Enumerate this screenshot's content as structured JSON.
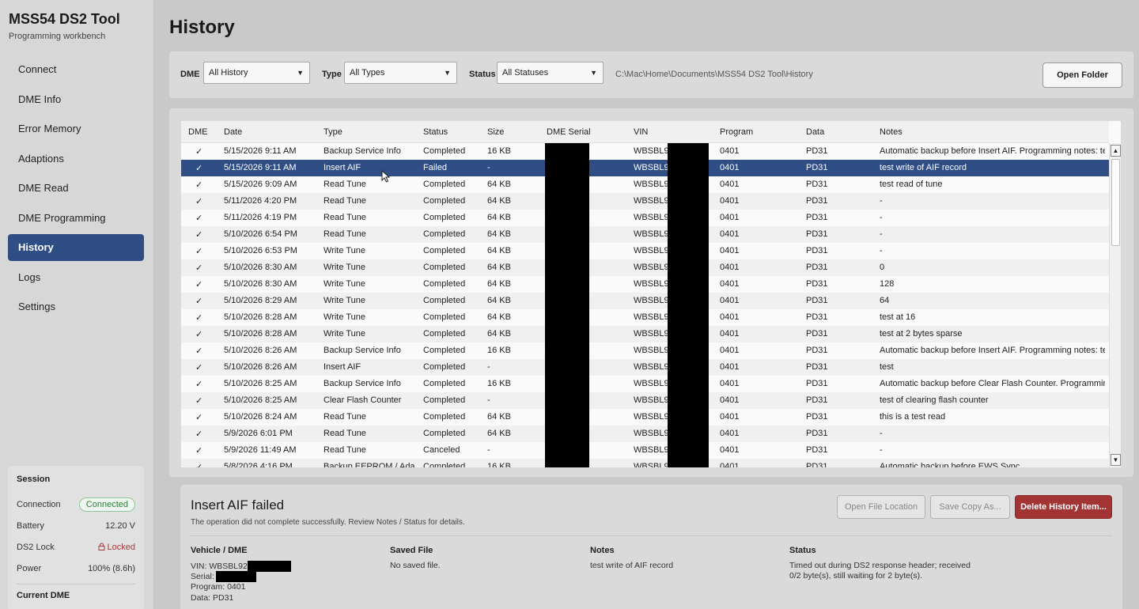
{
  "app": {
    "title": "MSS54 DS2 Tool",
    "subtitle": "Programming workbench"
  },
  "nav": [
    {
      "label": "Connect",
      "active": false
    },
    {
      "label": "DME Info",
      "active": false
    },
    {
      "label": "Error Memory",
      "active": false
    },
    {
      "label": "Adaptions",
      "active": false
    },
    {
      "label": "DME Read",
      "active": false
    },
    {
      "label": "DME Programming",
      "active": false
    },
    {
      "label": "History",
      "active": true
    },
    {
      "label": "Logs",
      "active": false
    },
    {
      "label": "Settings",
      "active": false
    }
  ],
  "session": {
    "title": "Session",
    "connection_label": "Connection",
    "connection_value": "Connected",
    "battery_label": "Battery",
    "battery_value": "12.20 V",
    "lock_label": "DS2 Lock",
    "lock_value": "Locked",
    "power_label": "Power",
    "power_value": "100% (8.6h)",
    "current_dme_label": "Current DME"
  },
  "page": {
    "title": "History"
  },
  "filters": {
    "dme_label": "DME",
    "dme_value": "All History",
    "type_label": "Type",
    "type_value": "All Types",
    "status_label": "Status",
    "status_value": "All Statuses",
    "path": "C:\\Mac\\Home\\Documents\\MSS54 DS2 Tool\\History",
    "open_folder": "Open Folder"
  },
  "table": {
    "headers": [
      "DME",
      "Date",
      "Type",
      "Status",
      "Size",
      "DME Serial",
      "VIN",
      "Program",
      "Data",
      "Notes"
    ],
    "selected_index": 1,
    "rows": [
      [
        "✓",
        "5/15/2026 9:11 AM",
        "Backup Service Info",
        "Completed",
        "16 KB",
        "",
        "WBSBL92",
        "0401",
        "PD31",
        "Automatic backup before Insert AIF. Programming notes: test..."
      ],
      [
        "✓",
        "5/15/2026 9:11 AM",
        "Insert AIF",
        "Failed",
        "-",
        "",
        "WBSBL92",
        "0401",
        "PD31",
        "test write of AIF record"
      ],
      [
        "✓",
        "5/15/2026 9:09 AM",
        "Read Tune",
        "Completed",
        "64 KB",
        "",
        "WBSBL92",
        "0401",
        "PD31",
        "test read of tune"
      ],
      [
        "✓",
        "5/11/2026 4:20 PM",
        "Read Tune",
        "Completed",
        "64 KB",
        "",
        "WBSBL92",
        "0401",
        "PD31",
        "-"
      ],
      [
        "✓",
        "5/11/2026 4:19 PM",
        "Read Tune",
        "Completed",
        "64 KB",
        "",
        "WBSBL92",
        "0401",
        "PD31",
        "-"
      ],
      [
        "✓",
        "5/10/2026 6:54 PM",
        "Read Tune",
        "Completed",
        "64 KB",
        "",
        "WBSBL92",
        "0401",
        "PD31",
        "-"
      ],
      [
        "✓",
        "5/10/2026 6:53 PM",
        "Write Tune",
        "Completed",
        "64 KB",
        "",
        "WBSBL92",
        "0401",
        "PD31",
        "-"
      ],
      [
        "✓",
        "5/10/2026 8:30 AM",
        "Write Tune",
        "Completed",
        "64 KB",
        "",
        "WBSBL92",
        "0401",
        "PD31",
        "0"
      ],
      [
        "✓",
        "5/10/2026 8:30 AM",
        "Write Tune",
        "Completed",
        "64 KB",
        "",
        "WBSBL92",
        "0401",
        "PD31",
        "128"
      ],
      [
        "✓",
        "5/10/2026 8:29 AM",
        "Write Tune",
        "Completed",
        "64 KB",
        "",
        "WBSBL92",
        "0401",
        "PD31",
        "64"
      ],
      [
        "✓",
        "5/10/2026 8:28 AM",
        "Write Tune",
        "Completed",
        "64 KB",
        "",
        "WBSBL92",
        "0401",
        "PD31",
        "test at 16"
      ],
      [
        "✓",
        "5/10/2026 8:28 AM",
        "Write Tune",
        "Completed",
        "64 KB",
        "",
        "WBSBL92",
        "0401",
        "PD31",
        "test at 2 bytes sparse"
      ],
      [
        "✓",
        "5/10/2026 8:26 AM",
        "Backup Service Info",
        "Completed",
        "16 KB",
        "",
        "WBSBL92",
        "0401",
        "PD31",
        "Automatic backup before Insert AIF. Programming notes: test"
      ],
      [
        "✓",
        "5/10/2026 8:26 AM",
        "Insert AIF",
        "Completed",
        "-",
        "",
        "WBSBL92",
        "0401",
        "PD31",
        "test"
      ],
      [
        "✓",
        "5/10/2026 8:25 AM",
        "Backup Service Info",
        "Completed",
        "16 KB",
        "",
        "WBSBL92",
        "0401",
        "PD31",
        "Automatic backup before Clear Flash Counter. Programming..."
      ],
      [
        "✓",
        "5/10/2026 8:25 AM",
        "Clear Flash Counter",
        "Completed",
        "-",
        "",
        "WBSBL92",
        "0401",
        "PD31",
        "test of clearing flash counter"
      ],
      [
        "✓",
        "5/10/2026 8:24 AM",
        "Read Tune",
        "Completed",
        "64 KB",
        "",
        "WBSBL92",
        "0401",
        "PD31",
        "this is a test read"
      ],
      [
        "✓",
        "5/9/2026 6:01 PM",
        "Read Tune",
        "Completed",
        "64 KB",
        "",
        "WBSBL92",
        "0401",
        "PD31",
        "-"
      ],
      [
        "✓",
        "5/9/2026 11:49 AM",
        "Read Tune",
        "Canceled",
        "-",
        "",
        "WBSBL92",
        "0401",
        "PD31",
        "-"
      ],
      [
        "✓",
        "5/8/2026 4:16 PM",
        "Backup EEPROM / Ada...",
        "Completed",
        "16 KB",
        "",
        "WBSBL92",
        "0401",
        "PD31",
        "Automatic backup before EWS Sync..."
      ]
    ]
  },
  "details": {
    "title": "Insert AIF failed",
    "subtitle": "The operation did not complete successfully. Review Notes / Status for details.",
    "open_location": "Open File Location",
    "save_copy": "Save Copy As...",
    "delete": "Delete History Item...",
    "vehicle_head": "Vehicle / DME",
    "vin_label": "VIN: WBSBL92",
    "serial_label": "Serial:",
    "program_label": "Program: 0401",
    "data_label": "Data: PD31",
    "saved_head": "Saved File",
    "saved_text": "No saved file.",
    "notes_head": "Notes",
    "notes_text": "test write of AIF record",
    "status_head": "Status",
    "status_line1": "Timed out during DS2 response header; received",
    "status_line2": "0/2 byte(s), still waiting for 2 byte(s)."
  },
  "colors": {
    "accent": "#2f4e86",
    "danger": "#a33434",
    "success": "#2e7d3a"
  }
}
